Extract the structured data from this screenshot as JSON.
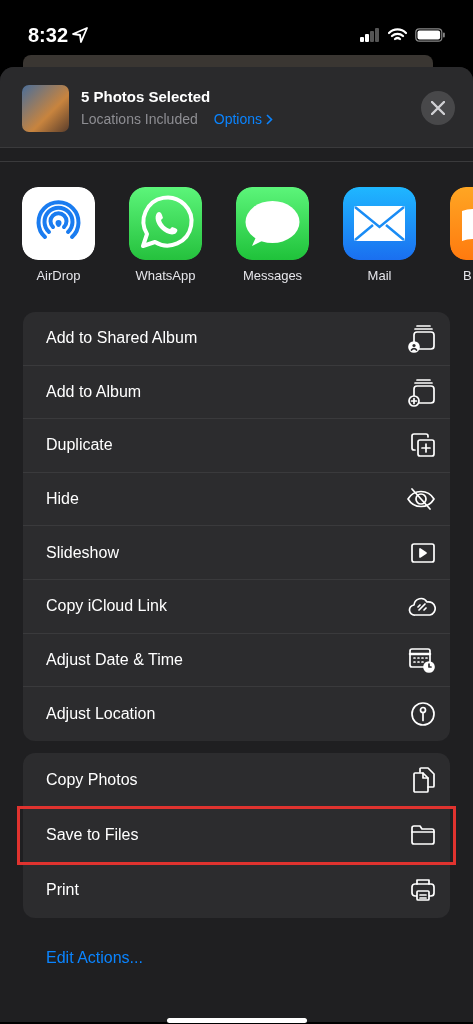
{
  "status_bar": {
    "time": "8:32"
  },
  "header": {
    "title": "5 Photos Selected",
    "subtitle": "Locations Included",
    "options_link": "Options"
  },
  "apps": [
    {
      "label": "AirDrop",
      "kind": "airdrop"
    },
    {
      "label": "WhatsApp",
      "kind": "whatsapp"
    },
    {
      "label": "Messages",
      "kind": "messages"
    },
    {
      "label": "Mail",
      "kind": "mail"
    },
    {
      "label": "B",
      "kind": "books",
      "cut_off": true
    }
  ],
  "action_groups": [
    {
      "items": [
        {
          "label": "Add to Shared Album",
          "kind": "shared-album",
          "highlighted": false
        },
        {
          "label": "Add to Album",
          "kind": "album",
          "highlighted": false
        },
        {
          "label": "Duplicate",
          "kind": "duplicate",
          "highlighted": false
        },
        {
          "label": "Hide",
          "kind": "hide",
          "highlighted": false
        },
        {
          "label": "Slideshow",
          "kind": "slideshow",
          "highlighted": false
        },
        {
          "label": "Copy iCloud Link",
          "kind": "cloud-link",
          "highlighted": false
        },
        {
          "label": "Adjust Date & Time",
          "kind": "calendar",
          "highlighted": false
        },
        {
          "label": "Adjust Location",
          "kind": "location",
          "highlighted": false
        }
      ]
    },
    {
      "items": [
        {
          "label": "Copy Photos",
          "kind": "copy",
          "highlighted": false
        },
        {
          "label": "Save to Files",
          "kind": "folder",
          "highlighted": true
        },
        {
          "label": "Print",
          "kind": "print",
          "highlighted": false
        }
      ]
    }
  ],
  "edit_actions": "Edit Actions..."
}
